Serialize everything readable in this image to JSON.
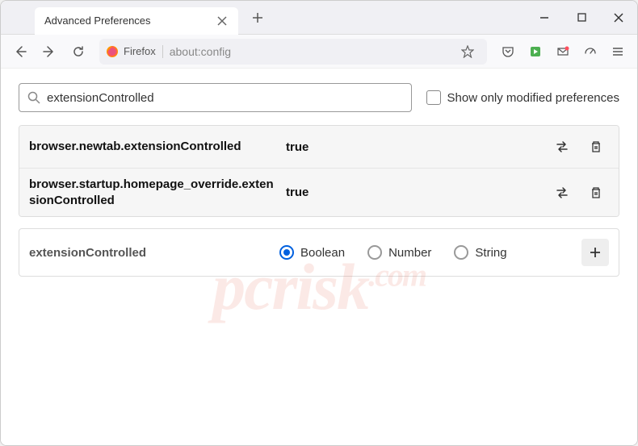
{
  "tab": {
    "title": "Advanced Preferences"
  },
  "urlbar": {
    "identity": "Firefox",
    "url": "about:config"
  },
  "search": {
    "value": "extensionControlled",
    "checkbox_label": "Show only modified preferences"
  },
  "prefs": [
    {
      "name": "browser.newtab.extensionControlled",
      "value": "true"
    },
    {
      "name": "browser.startup.homepage_override.extensionControlled",
      "value": "true"
    }
  ],
  "new_pref": {
    "name": "extensionControlled",
    "types": [
      "Boolean",
      "Number",
      "String"
    ],
    "selected": 0
  },
  "watermark": "pcrisk.com"
}
